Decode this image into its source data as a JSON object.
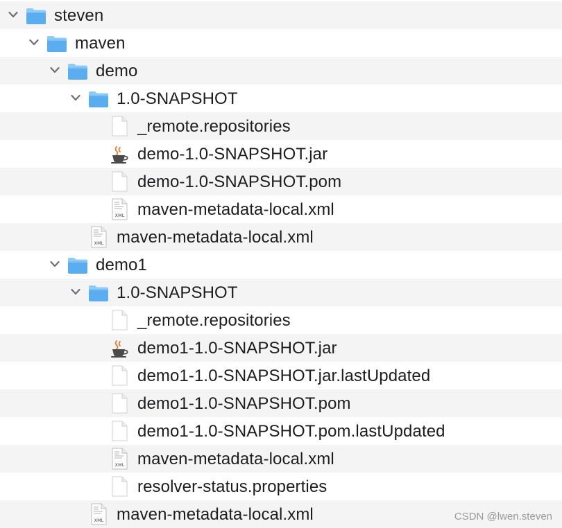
{
  "tree": {
    "rows": [
      {
        "label": "steven",
        "icon": "folder-icon",
        "expanded": true
      },
      {
        "label": "maven",
        "icon": "folder-icon",
        "expanded": true
      },
      {
        "label": "demo",
        "icon": "folder-icon",
        "expanded": true
      },
      {
        "label": "1.0-SNAPSHOT",
        "icon": "folder-icon",
        "expanded": true
      },
      {
        "label": "_remote.repositories",
        "icon": "document-icon"
      },
      {
        "label": "demo-1.0-SNAPSHOT.jar",
        "icon": "java-jar-icon"
      },
      {
        "label": "demo-1.0-SNAPSHOT.pom",
        "icon": "document-icon"
      },
      {
        "label": "maven-metadata-local.xml",
        "icon": "xml-file-icon",
        "icon_text": "XML"
      },
      {
        "label": "maven-metadata-local.xml",
        "icon": "xml-file-icon",
        "icon_text": "XML"
      },
      {
        "label": "demo1",
        "icon": "folder-icon",
        "expanded": true
      },
      {
        "label": "1.0-SNAPSHOT",
        "icon": "folder-icon",
        "expanded": true
      },
      {
        "label": "_remote.repositories",
        "icon": "document-icon"
      },
      {
        "label": "demo1-1.0-SNAPSHOT.jar",
        "icon": "java-jar-icon"
      },
      {
        "label": "demo1-1.0-SNAPSHOT.jar.lastUpdated",
        "icon": "document-icon"
      },
      {
        "label": "demo1-1.0-SNAPSHOT.pom",
        "icon": "document-icon"
      },
      {
        "label": "demo1-1.0-SNAPSHOT.pom.lastUpdated",
        "icon": "document-icon"
      },
      {
        "label": "maven-metadata-local.xml",
        "icon": "xml-file-icon",
        "icon_text": "XML"
      },
      {
        "label": "resolver-status.properties",
        "icon": "document-icon"
      },
      {
        "label": "maven-metadata-local.xml",
        "icon": "xml-file-icon",
        "icon_text": "XML"
      }
    ]
  },
  "watermark": "CSDN @lwen.steven",
  "colors": {
    "folder": "#5aaef0",
    "folder_tab": "#8ecbf7",
    "stripe": "#f4f4f4",
    "text": "#1d1d1f"
  }
}
